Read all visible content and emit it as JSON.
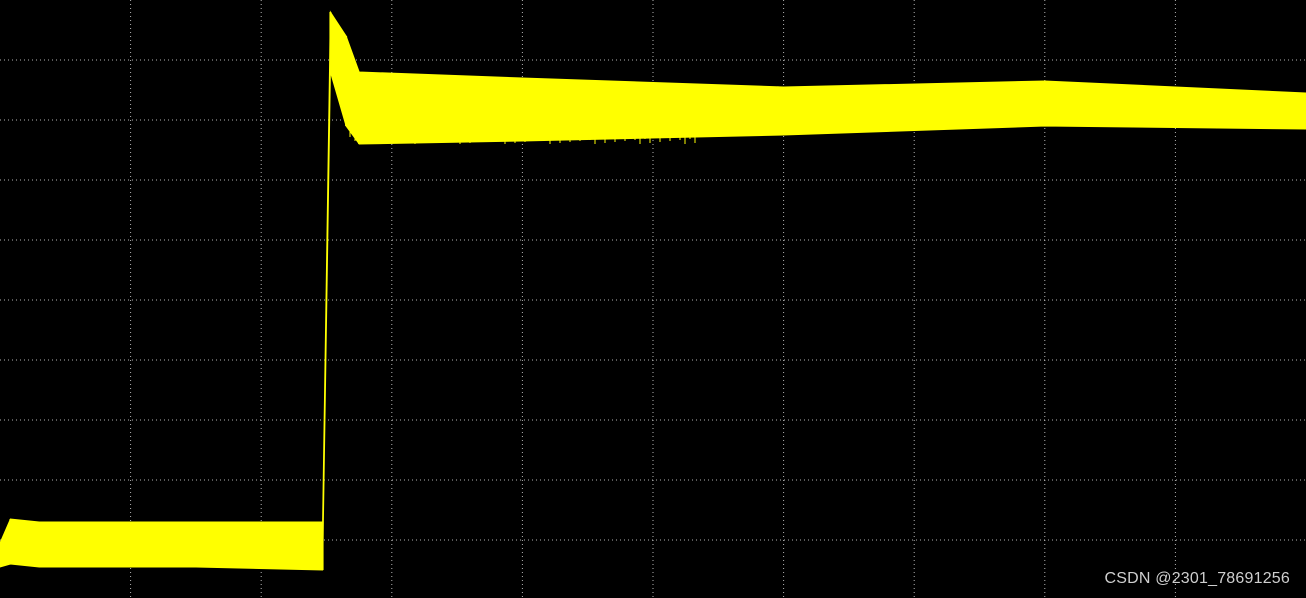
{
  "chart_data": {
    "type": "line",
    "title": "",
    "xlabel": "",
    "ylabel": "",
    "grid": true,
    "grid_divisions": {
      "x": 10,
      "y": 10
    },
    "xlim": [
      0,
      10
    ],
    "ylim": [
      0,
      10
    ],
    "colors": {
      "background": "#000000",
      "grid": "#ffffff",
      "trace": "#ffff00"
    },
    "series": [
      {
        "points": [
          {
            "x": 0.0,
            "y_low": 0.55,
            "y_high": 0.95
          },
          {
            "x": 0.08,
            "y_low": 0.6,
            "y_high": 1.35
          },
          {
            "x": 0.3,
            "y_low": 0.55,
            "y_high": 1.3
          },
          {
            "x": 1.5,
            "y_low": 0.55,
            "y_high": 1.3
          },
          {
            "x": 2.47,
            "y_low": 0.5,
            "y_high": 1.3
          },
          {
            "x": 2.53,
            "y_low": 8.8,
            "y_high": 9.8
          },
          {
            "x": 2.65,
            "y_low": 7.9,
            "y_high": 9.4
          },
          {
            "x": 2.75,
            "y_low": 7.6,
            "y_high": 8.8
          },
          {
            "x": 4.0,
            "y_low": 7.65,
            "y_high": 8.7
          },
          {
            "x": 6.0,
            "y_low": 7.75,
            "y_high": 8.55
          },
          {
            "x": 8.0,
            "y_low": 7.9,
            "y_high": 8.65
          },
          {
            "x": 10.0,
            "y_low": 7.85,
            "y_high": 8.45
          }
        ]
      }
    ]
  },
  "watermark": {
    "text": "CSDN @2301_78691256"
  }
}
